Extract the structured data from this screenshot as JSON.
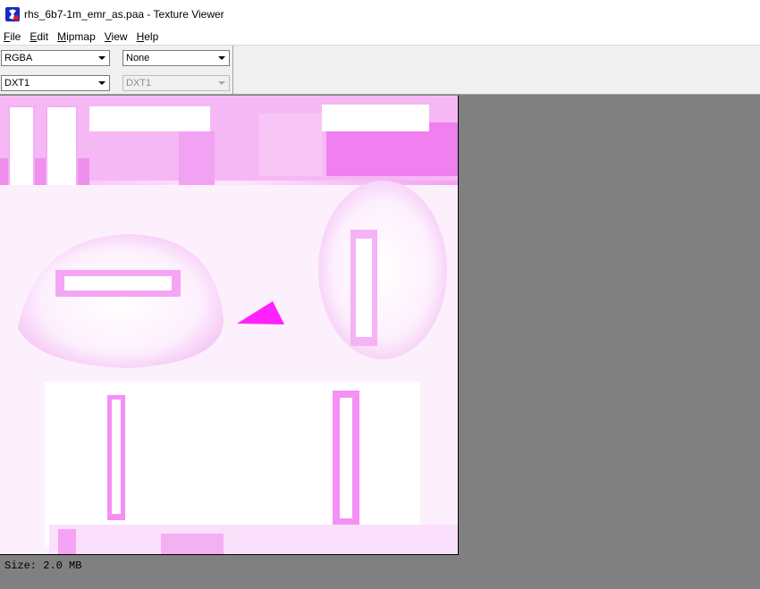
{
  "window": {
    "title": "rhs_6b7-1m_emr_as.paa - Texture Viewer",
    "app_icon": "texture-viewer-app-icon"
  },
  "menu": [
    {
      "name": "file",
      "accel": "F",
      "rest": "ile"
    },
    {
      "name": "edit",
      "accel": "E",
      "rest": "dit"
    },
    {
      "name": "mipmap",
      "accel": "M",
      "rest": "ipmap"
    },
    {
      "name": "view",
      "accel": "V",
      "rest": "iew"
    },
    {
      "name": "help",
      "accel": "H",
      "rest": "elp"
    }
  ],
  "toolbar": {
    "channel_select": {
      "value": "RGBA"
    },
    "filter_select": {
      "value": "None"
    },
    "format_select": {
      "value": "DXT1"
    },
    "target_format_select": {
      "value": "DXT1",
      "disabled": true
    }
  },
  "status": {
    "size_text": "Size: 2.0 MB"
  },
  "colors": {
    "texture_magenta": "#ff00ff",
    "texture_light": "#f5c8f5",
    "background_gray": "#808080"
  }
}
